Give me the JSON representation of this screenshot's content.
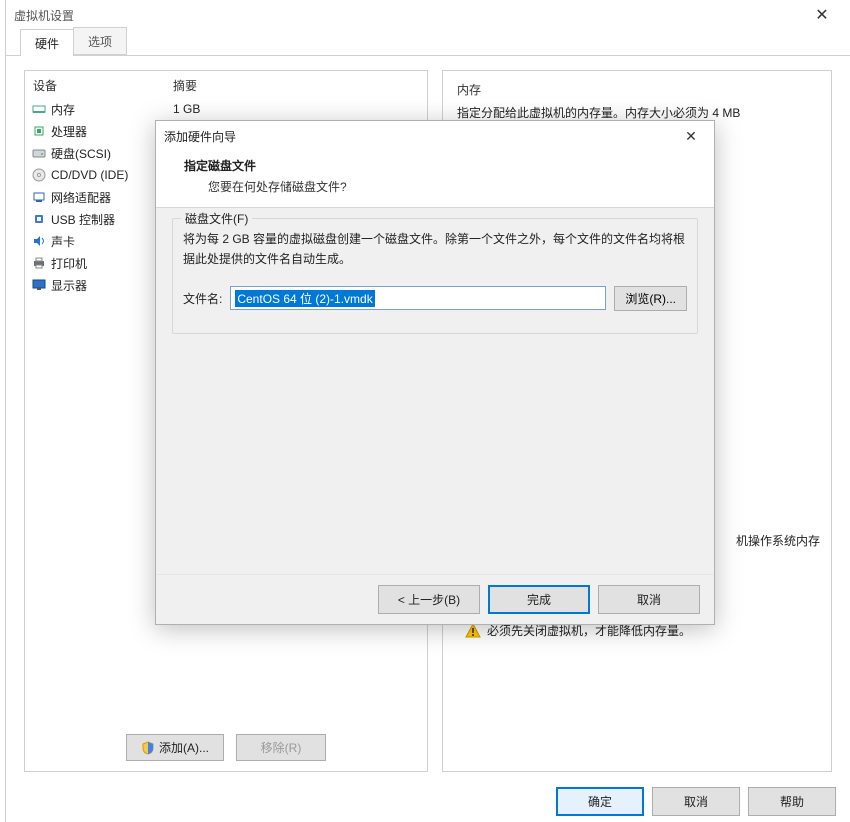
{
  "window": {
    "title": "虚拟机设置"
  },
  "tabs": {
    "hardware": "硬件",
    "options": "选项"
  },
  "devices": {
    "header_device": "设备",
    "header_summary": "摘要",
    "items": [
      {
        "name": "内存",
        "summary": "1 GB"
      },
      {
        "name": "处理器",
        "summary": ""
      },
      {
        "name": "硬盘(SCSI)",
        "summary": ""
      },
      {
        "name": "CD/DVD (IDE)",
        "summary": ""
      },
      {
        "name": "网络适配器",
        "summary": ""
      },
      {
        "name": "USB 控制器",
        "summary": ""
      },
      {
        "name": "声卡",
        "summary": ""
      },
      {
        "name": "打印机",
        "summary": ""
      },
      {
        "name": "显示器",
        "summary": ""
      }
    ],
    "add_button": "添加(A)...",
    "remove_button": "移除(R)"
  },
  "right": {
    "heading": "内存",
    "desc": "指定分配给此虚拟机的内存量。内存大小必须为 4 MB",
    "os_hint": "机操作系统内存"
  },
  "warning_partial": "必须先关闭虚拟机，才能降低内存量。",
  "footer": {
    "ok": "确定",
    "cancel": "取消",
    "help": "帮助"
  },
  "wizard": {
    "title": "添加硬件向导",
    "heading": "指定磁盘文件",
    "subheading": "您要在何处存储磁盘文件?",
    "group_label": "磁盘文件(F)",
    "group_desc": "将为每 2 GB 容量的虚拟磁盘创建一个磁盘文件。除第一个文件之外，每个文件的文件名均将根据此处提供的文件名自动生成。",
    "file_label": "文件名:",
    "file_value": "CentOS 64 位 (2)-1.vmdk",
    "browse": "浏览(R)...",
    "back": "< 上一步(B)",
    "finish": "完成",
    "cancel": "取消"
  }
}
